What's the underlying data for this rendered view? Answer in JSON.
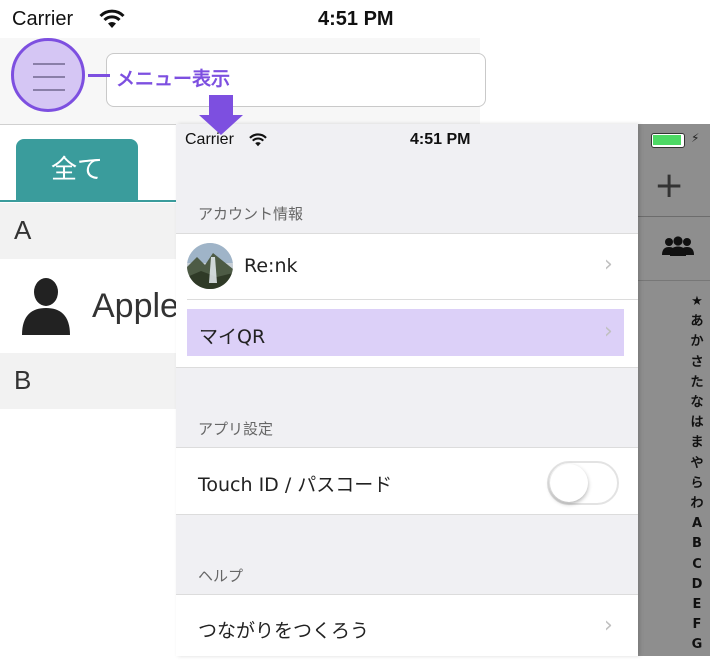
{
  "back_screen": {
    "status_bar": {
      "carrier": "Carrier",
      "time": "4:51 PM"
    },
    "callout_label": "メニュー表示",
    "tabs": [
      {
        "label": "全て"
      }
    ],
    "sections": [
      {
        "header": "A"
      },
      {
        "header": "B"
      }
    ],
    "contacts": [
      {
        "name": "Apple"
      }
    ]
  },
  "index_bar": {
    "letters": [
      "★",
      "あ",
      "か",
      "さ",
      "た",
      "な",
      "は",
      "ま",
      "や",
      "ら",
      "わ",
      "A",
      "B",
      "C",
      "D",
      "E",
      "F",
      "G"
    ]
  },
  "drawer": {
    "status_bar": {
      "carrier": "Carrier",
      "time": "4:51 PM"
    },
    "account_section": {
      "header": "アカウント情報",
      "profile_name": "Re:nk",
      "my_qr_label": "マイQR"
    },
    "app_settings_section": {
      "header": "アプリ設定",
      "touch_id_label": "Touch ID / パスコード",
      "touch_id_enabled": false
    },
    "help_section": {
      "header": "ヘルプ",
      "connect_label": "つながりをつくろう"
    }
  },
  "colors": {
    "accent_purple": "#7d4fe0",
    "highlight_purple": "#dcd0f8",
    "tab_teal": "#3a9c9c",
    "battery_green": "#4cd964"
  },
  "icons": {
    "menu": "hamburger-icon",
    "wifi": "wifi-icon",
    "add": "plus-icon",
    "group": "people-icon",
    "contact": "person-icon",
    "disclosure": "chevron-right-icon"
  }
}
